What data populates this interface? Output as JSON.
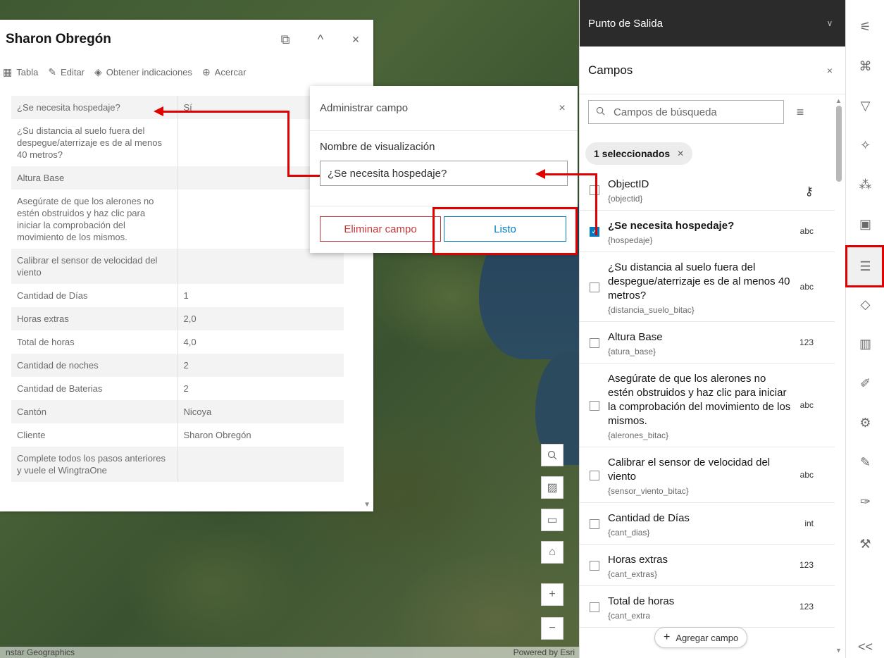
{
  "map": {
    "attribution_left": "nstar Geographics",
    "attribution_right": "Powered by Esri"
  },
  "popup": {
    "title": "Sharon Obregón",
    "actions": [
      {
        "icon": "table-icon",
        "label": "Tabla"
      },
      {
        "icon": "edit-icon",
        "label": "Editar"
      },
      {
        "icon": "directions-icon",
        "label": "Obtener indicaciones"
      },
      {
        "icon": "zoom-to-icon",
        "label": "Acercar"
      }
    ],
    "rows": [
      {
        "k": "¿Se necesita hospedaje?",
        "v": "Sí"
      },
      {
        "k": "¿Su distancia al suelo fuera del despegue/aterrizaje es de al menos 40 metros?",
        "v": ""
      },
      {
        "k": "Altura Base",
        "v": ""
      },
      {
        "k": "Asegúrate de que los alerones no estén obstruidos y haz clic para iniciar la comprobación del movimiento de los mismos.",
        "v": ""
      },
      {
        "k": "Calibrar el sensor de velocidad del viento",
        "v": ""
      },
      {
        "k": "Cantidad de Días",
        "v": "1"
      },
      {
        "k": "Horas extras",
        "v": "2,0"
      },
      {
        "k": "Total de horas",
        "v": "4,0"
      },
      {
        "k": "Cantidad de noches",
        "v": "2"
      },
      {
        "k": "Cantidad de Baterias",
        "v": "2"
      },
      {
        "k": "Cantón",
        "v": "Nicoya"
      },
      {
        "k": "Cliente",
        "v": "Sharon Obregón"
      },
      {
        "k": "Complete todos los pasos anteriores y vuele el WingtraOne",
        "v": ""
      }
    ]
  },
  "dialog": {
    "title": "Administrar campo",
    "label": "Nombre de visualización",
    "value": "¿Se necesita hospedaje?",
    "delete_label": "Eliminar campo",
    "done_label": "Listo"
  },
  "panel": {
    "layer": "Punto de Salida",
    "section": "Campos",
    "search_placeholder": "Campos de búsqueda",
    "chip": "1 seleccionados",
    "add_field": "Agregar campo",
    "fields": [
      {
        "name": "ObjectID",
        "alias": "{objectid}",
        "type": "key",
        "checked": false
      },
      {
        "name": "¿Se necesita hospedaje?",
        "alias": "{hospedaje}",
        "type": "abc",
        "checked": true
      },
      {
        "name": "¿Su distancia al suelo fuera del despegue/aterrizaje es de al menos 40 metros?",
        "alias": "{distancia_suelo_bitac}",
        "type": "abc",
        "checked": false
      },
      {
        "name": "Altura Base",
        "alias": "{atura_base}",
        "type": "123",
        "checked": false
      },
      {
        "name": "Asegúrate de que los alerones no estén obstruidos y haz clic para iniciar la comprobación del movimiento de los mismos.",
        "alias": "{alerones_bitac}",
        "type": "abc",
        "checked": false
      },
      {
        "name": "Calibrar el sensor de velocidad del viento",
        "alias": "{sensor_viento_bitac}",
        "type": "abc",
        "checked": false
      },
      {
        "name": "Cantidad de Días",
        "alias": "{cant_dias}",
        "type": "int",
        "checked": false
      },
      {
        "name": "Horas extras",
        "alias": "{cant_extras}",
        "type": "123",
        "checked": false
      },
      {
        "name": "Total de horas",
        "alias": "{cant_extra",
        "type": "123",
        "checked": false
      }
    ]
  },
  "toolbar": {
    "collapse": "<<"
  }
}
